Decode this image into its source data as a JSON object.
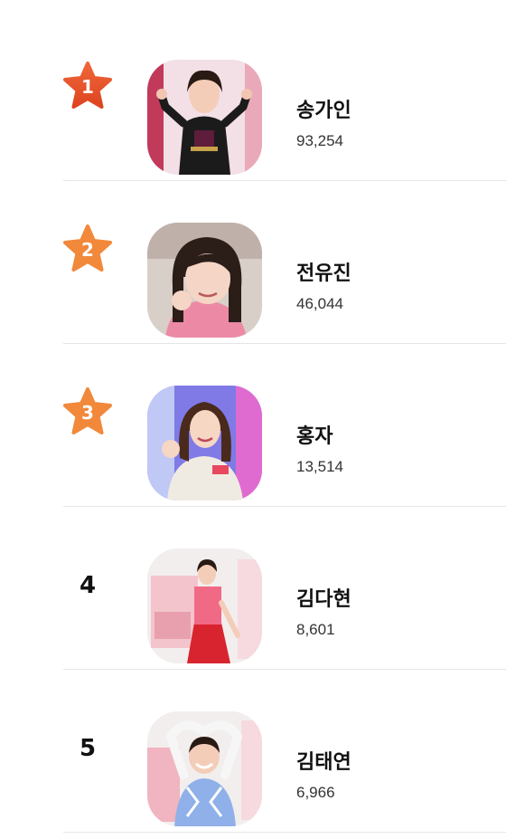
{
  "ranking": {
    "items": [
      {
        "rank": "1",
        "name": "송가인",
        "votes": "93,254",
        "badge": "star",
        "star_color": "#e8502a"
      },
      {
        "rank": "2",
        "name": "전유진",
        "votes": "46,044",
        "badge": "star",
        "star_color": "#f1883a"
      },
      {
        "rank": "3",
        "name": "홍자",
        "votes": "13,514",
        "badge": "star",
        "star_color": "#f1883a"
      },
      {
        "rank": "4",
        "name": "김다현",
        "votes": "8,601",
        "badge": "number"
      },
      {
        "rank": "5",
        "name": "김태연",
        "votes": "6,966",
        "badge": "number"
      }
    ]
  }
}
